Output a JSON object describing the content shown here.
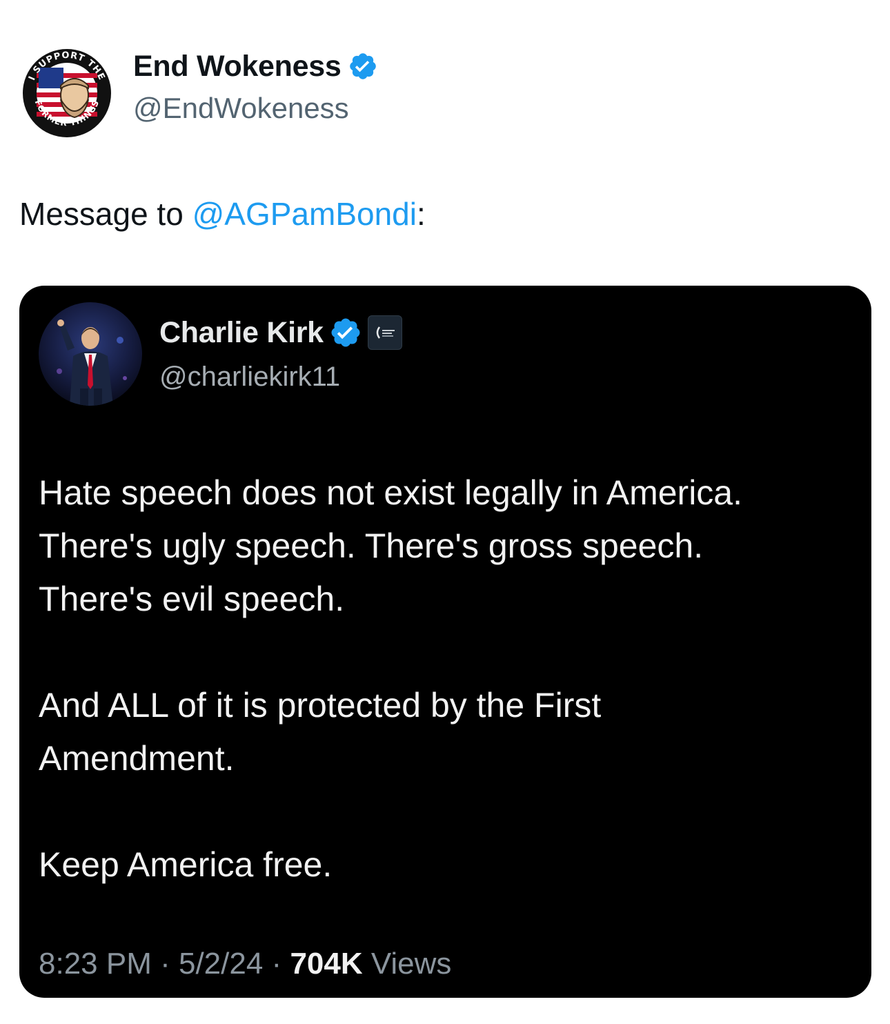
{
  "author": {
    "display_name": "End Wokeness",
    "handle": "@EndWokeness",
    "verified": true,
    "avatar_text_top": "I SUPPORT THE",
    "avatar_text_bottom": "FORMER THINGS"
  },
  "tweet": {
    "text_prefix": "Message to ",
    "mention": "@AGPamBondi",
    "text_suffix": ":"
  },
  "embedded_tweet": {
    "display_name": "Charlie Kirk",
    "handle": "@charliekirk11",
    "verified": true,
    "affiliate_badge": "turning-point-usa-logo",
    "paragraphs": [
      "Hate speech does not exist legally in America.\nThere's ugly speech. There's gross speech.\nThere's evil speech.",
      "And ALL of it is protected by the First\nAmendment.",
      "Keep America free."
    ],
    "time": "8:23 PM",
    "separator": " · ",
    "date": "5/2/24",
    "views_count": "704K",
    "views_label": " Views"
  },
  "colors": {
    "link": "#1d9bf0",
    "verified": "#1d9bf0",
    "secondary_text": "#536471",
    "card_background": "#000000"
  }
}
